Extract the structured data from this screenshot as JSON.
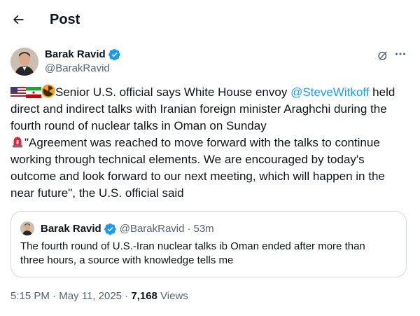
{
  "header": {
    "title": "Post",
    "back_icon": "arrow-left-icon"
  },
  "author": {
    "name": "Barak Ravid",
    "handle": "@BarakRavid",
    "verified_color": "#1d9bf0"
  },
  "tweet": {
    "line1_text": "Senior U.S. official says White House envoy ",
    "line1_mention": "@SteveWitkoff",
    "line1_end": " held",
    "line2": "direct and indirect talks with Iranian foreign minister Araghchi during the",
    "line3": "fourth round of nuclear talks in Oman on Sunday",
    "line4": "\"Agreement was reached to move forward with the talks to continue",
    "line5": "working through technical elements. We are encouraged by today's",
    "line6": "outcome and look forward to our next meeting, which will happen in the",
    "line7": "near future\", the U.S. official said",
    "emojis": [
      "flag-us-icon",
      "flag-iran-icon",
      "radioactive-icon",
      "siren-icon"
    ]
  },
  "quote": {
    "name": "Barak Ravid",
    "handle": "@BarakRavid",
    "separator": "·",
    "time": "53m",
    "line1": "The fourth round of U.S.-Iran nuclear talks ib Oman ended after more than",
    "line2": "three hours, a source with knowledge tells me"
  },
  "meta": {
    "time": "5:15 PM",
    "sep1": "·",
    "date": "May 11, 2025",
    "sep2": "·",
    "views_count": "7,168",
    "views_label": "Views"
  },
  "colors": {
    "accent": "#1d9bf0",
    "text": "#0f1419",
    "muted": "#536471",
    "border": "#cfd9de"
  }
}
